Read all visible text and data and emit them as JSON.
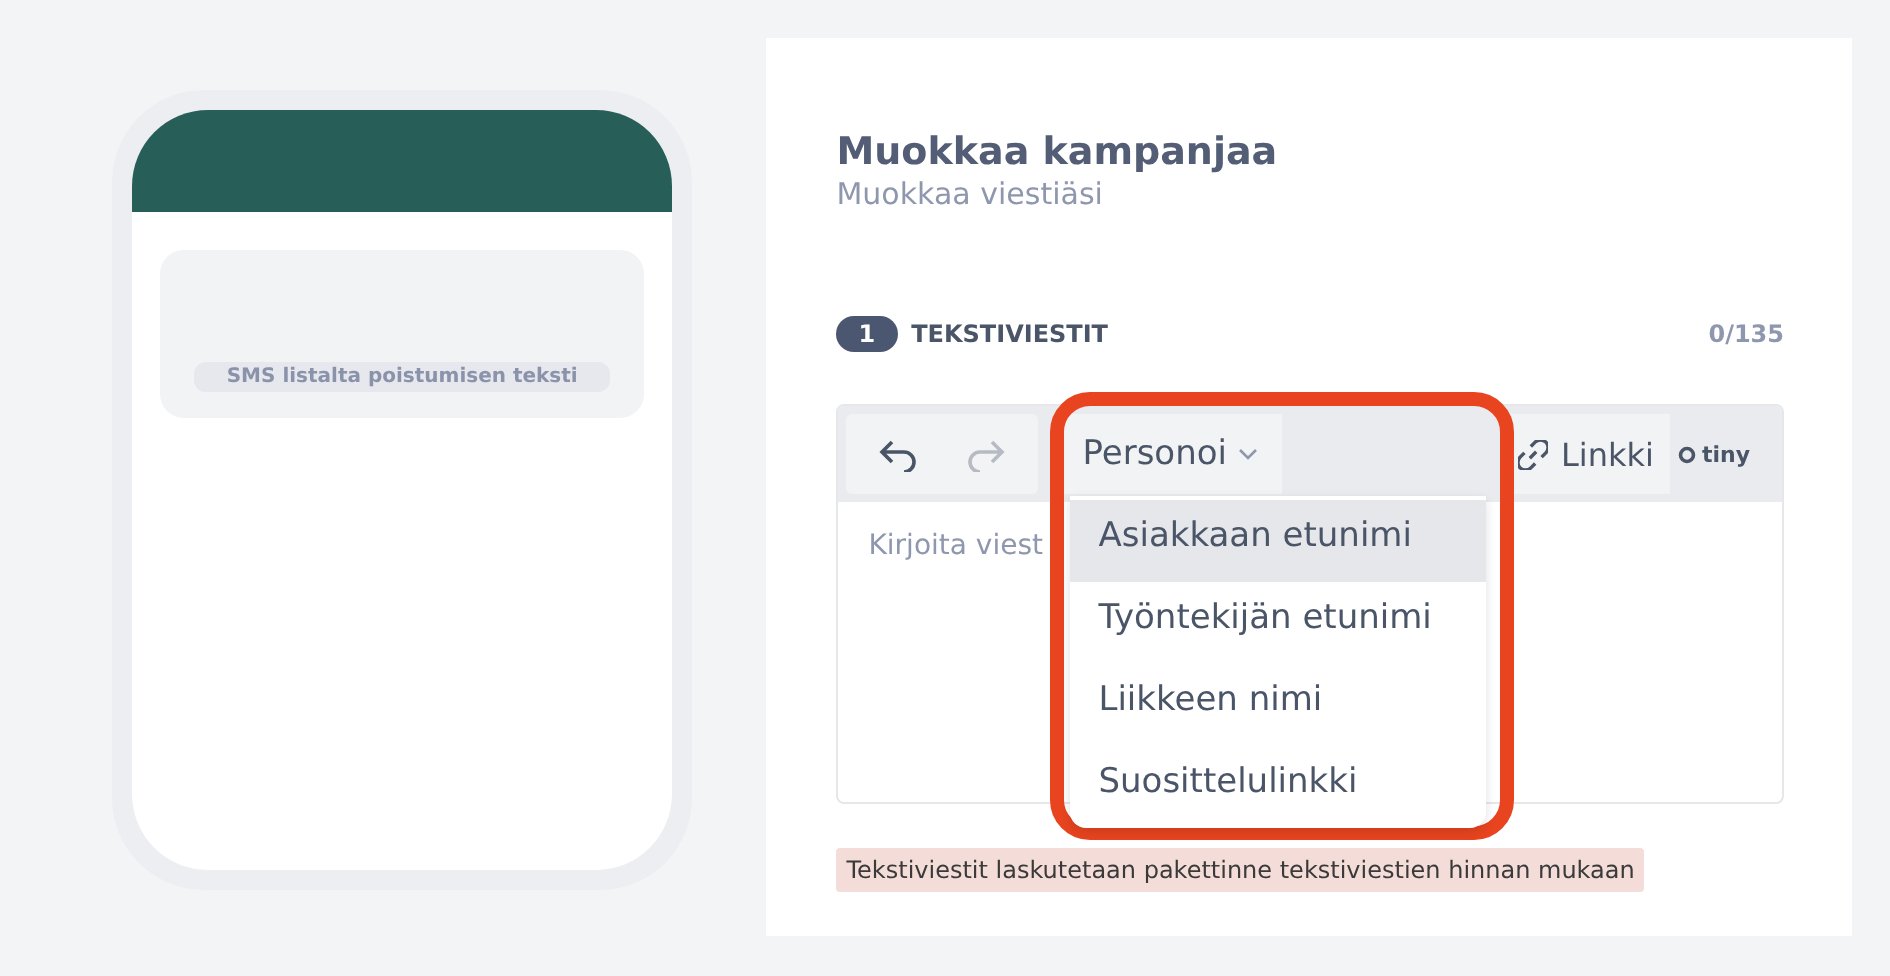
{
  "preview": {
    "unsubscribe_text": "SMS listalta poistumisen teksti"
  },
  "header": {
    "title": "Muokkaa kampanjaa",
    "subtitle": "Muokkaa viestiäsi"
  },
  "section": {
    "step": "1",
    "label": "TEKSTIVIESTIT",
    "counter": "0/135"
  },
  "toolbar": [
    {
      "kind": "undo",
      "disabled": false
    },
    {
      "kind": "redo",
      "disabled": true
    },
    {
      "kind": "menu",
      "label": "Personoi",
      "expanded": true
    },
    {
      "kind": "link",
      "label": "Linkki"
    }
  ],
  "brand": "tiny",
  "editor": {
    "placeholder": "Kirjoita viest"
  },
  "menu": [
    {
      "label": "Asiakkaan etunimi",
      "selected": true
    },
    {
      "label": "Työntekijän etunimi",
      "selected": false
    },
    {
      "label": "Liikkeen nimi",
      "selected": false
    },
    {
      "label": "Suosittelulinkki",
      "selected": false
    }
  ],
  "notice": "Tekstiviestit laskutetaan pakettinne tekstiviestien hinnan mukaan"
}
